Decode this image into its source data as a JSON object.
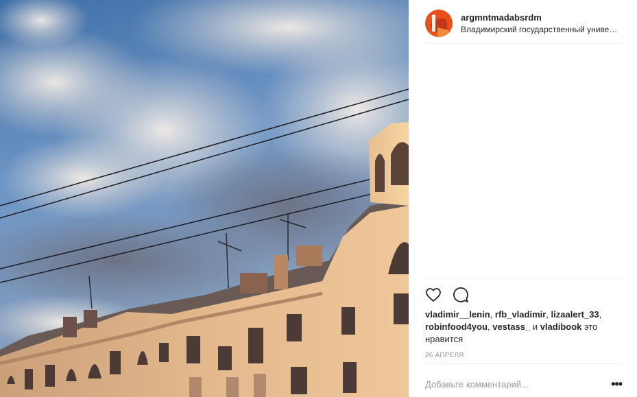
{
  "post": {
    "username": "argmntmadabsrdm",
    "location": "Владимирский государственный университет",
    "likes_prefix_users": [
      "vladimir__lenin",
      "rfb_vladimir",
      "lizaalert_33",
      "robinfood4you",
      "vestass_"
    ],
    "likes_and": "и",
    "likes_last_user": "vladibook",
    "likes_suffix": "это нравится",
    "date": "26 апреля",
    "comment_placeholder": "Добавьте комментарий...",
    "more_label": "•••"
  },
  "icons": {
    "like": "heart-outline-icon",
    "comment": "speech-bubble-icon",
    "more": "ellipsis-icon"
  },
  "colors": {
    "avatar_bg": "#e8501b",
    "text": "#262626",
    "muted": "#999999",
    "divider": "#efefef"
  }
}
